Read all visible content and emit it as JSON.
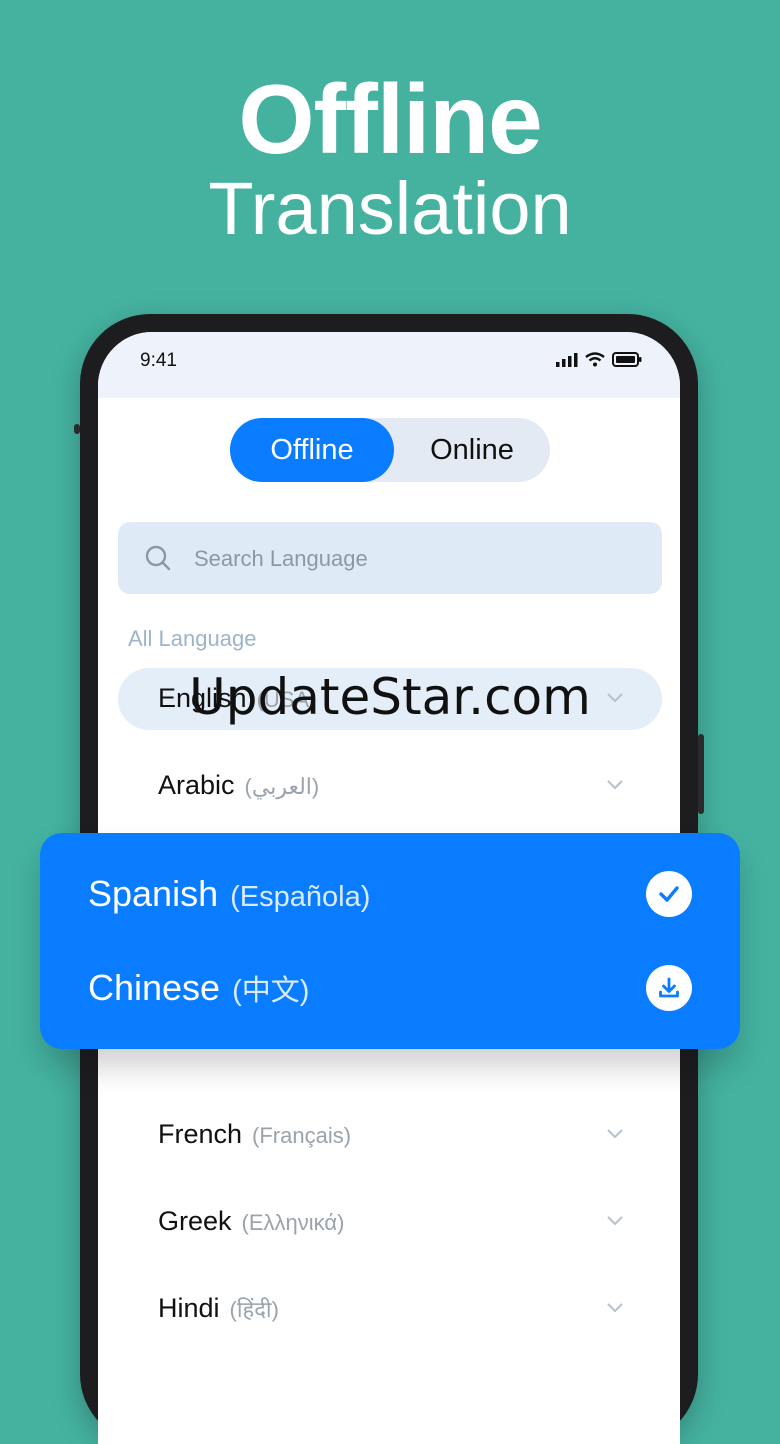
{
  "headline": {
    "line1": "Offline",
    "line2": "Translation"
  },
  "status": {
    "time": "9:41"
  },
  "mode_toggle": {
    "offline_label": "Offline",
    "online_label": "Online",
    "selected": "Offline"
  },
  "search": {
    "placeholder": "Search Language"
  },
  "section_label": "All Language",
  "languages": [
    {
      "name": "English",
      "native": "(USA)"
    },
    {
      "name": "Arabic",
      "native": "(العربي)"
    },
    {
      "name": "French",
      "native": "(Français)"
    },
    {
      "name": "Greek",
      "native": "(Ελληνικά)"
    },
    {
      "name": "Hindi",
      "native": "(हिंदी)"
    }
  ],
  "popup": {
    "items": [
      {
        "name": "Spanish",
        "native": "(Española)",
        "action": "check-icon"
      },
      {
        "name": "Chinese",
        "native": "(中文)",
        "action": "download-icon"
      }
    ]
  },
  "watermark": "UpdateStar.com",
  "colors": {
    "background": "#45b2a0",
    "accent": "#0a7cff"
  }
}
